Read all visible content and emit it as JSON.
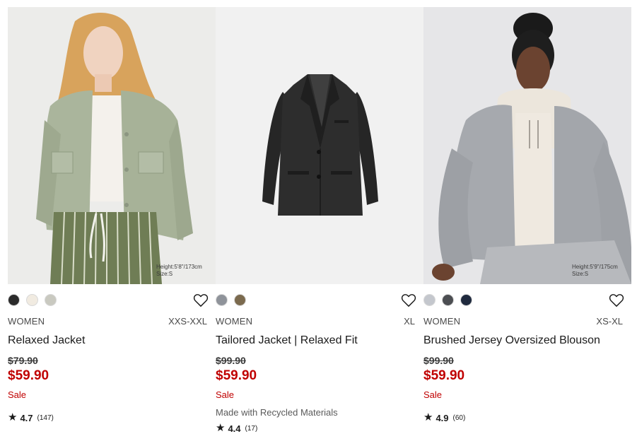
{
  "products": [
    {
      "gender": "WOMEN",
      "size_range": "XXS-XXL",
      "name": "Relaxed Jacket",
      "original_price": "$79.90",
      "sale_price": "$59.90",
      "flag": "Sale",
      "note": "",
      "rating": "4.7",
      "review_count": "(147)",
      "model_height": "Height:5'8\"/173cm",
      "model_size": "Size:S",
      "colors": [
        "#2b2b2b",
        "#f1ebe1",
        "#c9c9c0"
      ]
    },
    {
      "gender": "WOMEN",
      "size_range": "XL",
      "name": "Tailored Jacket | Relaxed Fit",
      "original_price": "$99.90",
      "sale_price": "$59.90",
      "flag": "Sale",
      "note": "Made with Recycled Materials",
      "rating": "4.4",
      "review_count": "(17)",
      "model_height": "",
      "model_size": "",
      "colors": [
        "#8f939a",
        "#7b6a4e"
      ]
    },
    {
      "gender": "WOMEN",
      "size_range": "XS-XL",
      "name": "Brushed Jersey Oversized Blouson",
      "original_price": "$99.90",
      "sale_price": "$59.90",
      "flag": "Sale",
      "note": "",
      "rating": "4.9",
      "review_count": "(60)",
      "model_height": "Height:5'9\"/175cm",
      "model_size": "Size:S",
      "colors": [
        "#c4c7cd",
        "#4c4e52",
        "#1f2a3e"
      ]
    }
  ],
  "icons": {
    "favorite": "heart-outline-icon",
    "rating": "star-icon",
    "star_glyph": "★"
  },
  "accent": {
    "sale_red": "#c00000"
  }
}
